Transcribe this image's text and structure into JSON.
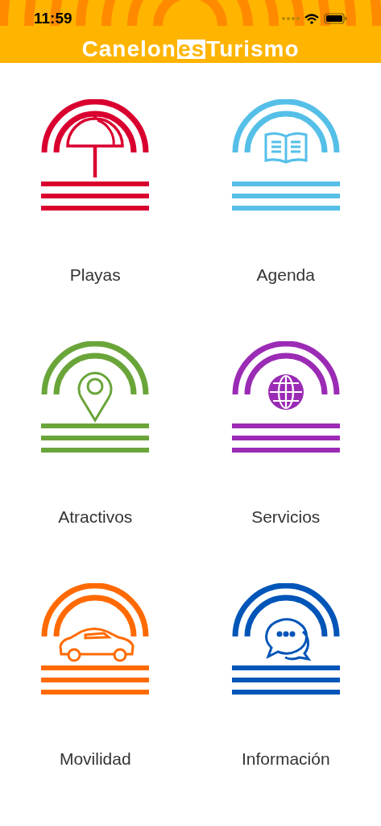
{
  "status_bar": {
    "time": "11:59"
  },
  "header": {
    "title_start": "Canelon",
    "title_highlight": "es",
    "title_end": "Turismo"
  },
  "tiles": [
    {
      "label": "Playas",
      "kind": "umbrella",
      "color": "#d9002f"
    },
    {
      "label": "Agenda",
      "kind": "book",
      "color": "#55bfe8"
    },
    {
      "label": "Atractivos",
      "kind": "pin",
      "color": "#6aa53a"
    },
    {
      "label": "Servicios",
      "kind": "globe",
      "color": "#9b2bb5"
    },
    {
      "label": "Movilidad",
      "kind": "car",
      "color": "#ff6a00"
    },
    {
      "label": "Información",
      "kind": "chat",
      "color": "#0055b8"
    }
  ]
}
